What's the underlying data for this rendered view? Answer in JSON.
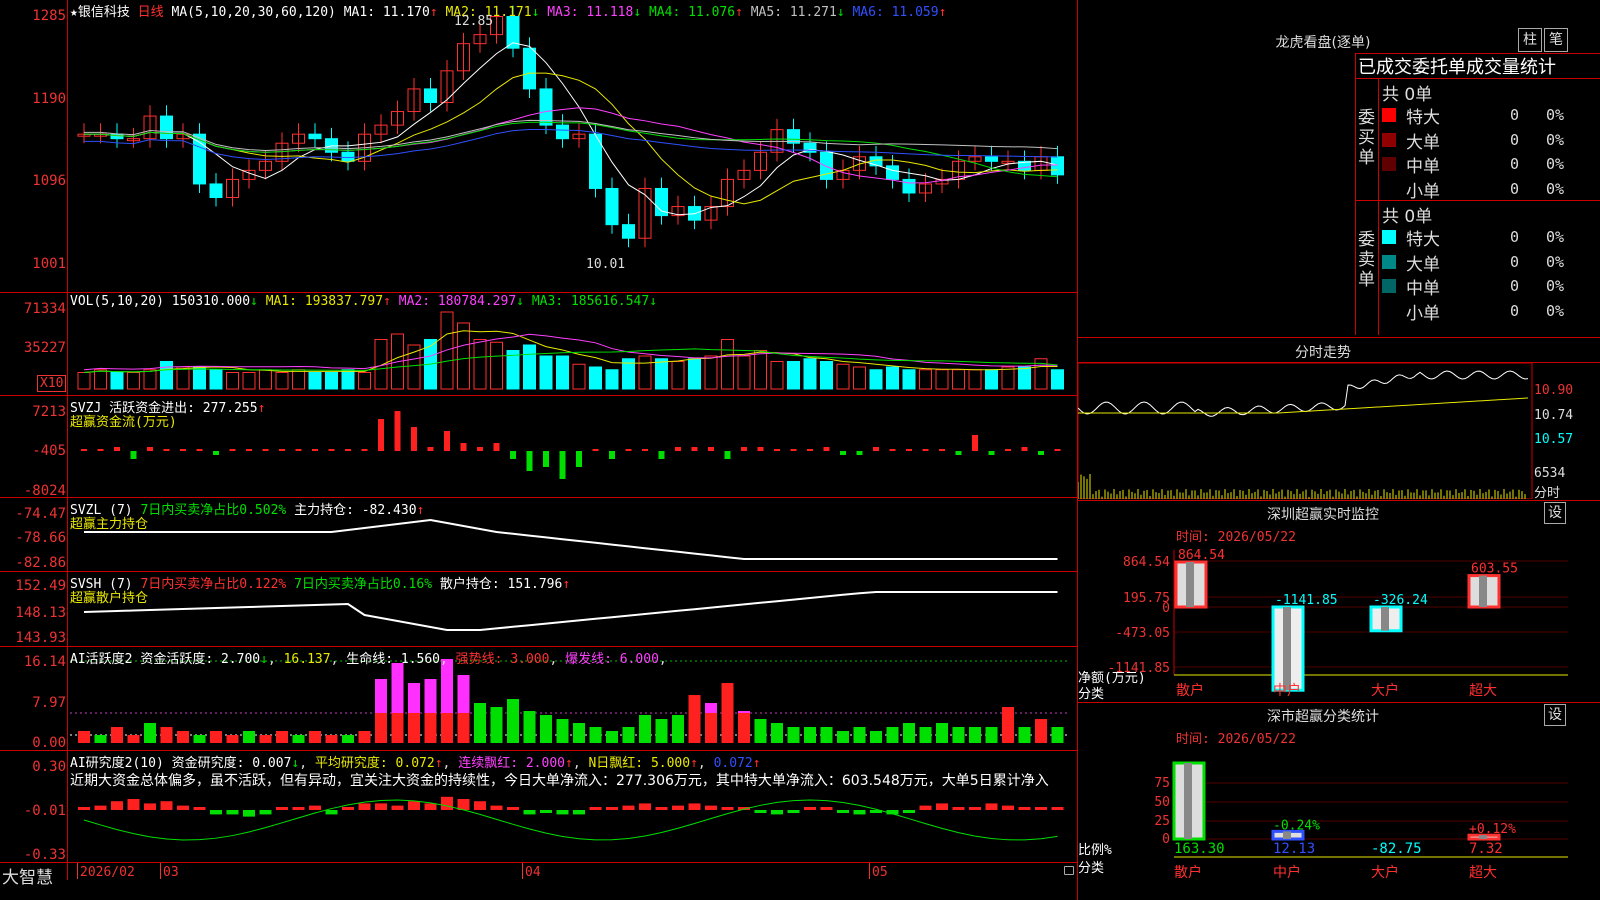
{
  "stock": {
    "name": "银信科技",
    "period": "日线",
    "star": "★"
  },
  "main_header": {
    "ma_param": "MA(5,10,20,30,60,120)",
    "items": [
      {
        "label": "MA1:",
        "value": "11.170",
        "arrow": "↑",
        "color": "#ffffff"
      },
      {
        "label": "MA2:",
        "value": "11.171",
        "arrow": "↓",
        "color": "#e8e800"
      },
      {
        "label": "MA3:",
        "value": "11.118",
        "arrow": "↓",
        "color": "#ff40ff"
      },
      {
        "label": "MA4:",
        "value": "11.076",
        "arrow": "↑",
        "color": "#00e000"
      },
      {
        "label": "MA5:",
        "value": "11.271",
        "arrow": "↓",
        "color": "#c0c0c0"
      },
      {
        "label": "MA6:",
        "value": "11.059",
        "arrow": "↑",
        "color": "#3050ff"
      }
    ]
  },
  "y_labels": {
    "price": [
      "1285",
      "1190",
      "1096",
      "1001"
    ],
    "vol": [
      "71334",
      "35227",
      "X10"
    ],
    "svzj": [
      "7213",
      "-405",
      "-8024"
    ],
    "svzl": [
      "-74.47",
      "-78.66",
      "-82.86"
    ],
    "svsh": [
      "152.49",
      "148.13",
      "143.93"
    ],
    "ai1": [
      "16.14",
      "7.97",
      "0.00"
    ],
    "ai2": [
      "0.30",
      "-0.01",
      "-0.33"
    ]
  },
  "price_annotations": {
    "high": "12.85",
    "low": "10.01"
  },
  "vol_header": {
    "param": "VOL(5,10,20)",
    "value": "150310.000",
    "arrow": "↓",
    "ma1": "MA1: 193837.797",
    "ma1_arrow": "↑",
    "ma2": "MA2: 180784.297",
    "ma2_arrow": "↓",
    "ma3": "MA3: 185616.547",
    "ma3_arrow": "↓"
  },
  "svzj_header": {
    "name": "SVZJ",
    "text": "活跃资金进出: 277.255",
    "arrow": "↑",
    "sub": "超赢资金流(万元)"
  },
  "svzl_header": {
    "name": "SVZL (7)",
    "text1": "7日内买卖净占比0.502%",
    "text2": "主力持仓: -82.430",
    "arrow": "↑",
    "sub": "超赢主力持仓"
  },
  "svsh_header": {
    "name": "SVSH (7)",
    "text1": "7日内买卖净占比0.122%",
    "text2": "7日内买卖净占比0.16%",
    "text3": "散户持仓: 151.796",
    "arrow": "↑",
    "sub": "超赢散户持仓"
  },
  "ai1_header": {
    "name": "AI活跃度2",
    "text": "资金活跃度: 2.700",
    "arrow": "↓",
    "v2": "16.137",
    "text2": "生命线: 1.560",
    "strong": "强势线: 3.000",
    "burst": "爆发线: 6.000"
  },
  "ai2_header": {
    "name": "AI研究度2(10)",
    "text": "资金研究度: 0.007",
    "arrow": "↓",
    "avg": "平均研究度: 0.072",
    "avg_arrow": "↑",
    "streak": "连续飘红: 2.000",
    "streak_arrow": "↑",
    "n": "N日飘红: 5.000",
    "n_arrow": "↑",
    "last": "0.072",
    "last_arrow": "↑"
  },
  "comment": "近期大资金总体偏多，虽不活跃，但有异动，宜关注大资金的持续性，今日大单净流入：277.306万元，其中特大单净流入：603.548万元，大单5日累计净入",
  "bottom_axis": {
    "brand": "大智慧",
    "labels": [
      "2026/02",
      "03",
      "04",
      "05"
    ]
  },
  "dragon": {
    "title": "龙虎看盘(逐单)",
    "btn1": "柱",
    "btn2": "笔",
    "subtitle": "已成交委托单成交量统计",
    "buy": {
      "side": "委买单",
      "total": "共 0单",
      "rows": [
        {
          "label": "特大",
          "count": "0",
          "pct": "0%",
          "color": "#ff0000"
        },
        {
          "label": "大单",
          "count": "0",
          "pct": "0%",
          "color": "#900000"
        },
        {
          "label": "中单",
          "count": "0",
          "pct": "0%",
          "color": "#600000"
        },
        {
          "label": "小单",
          "count": "0",
          "pct": "0%",
          "color": "#000000"
        }
      ]
    },
    "sell": {
      "side": "委卖单",
      "total": "共 0单",
      "rows": [
        {
          "label": "特大",
          "count": "0",
          "pct": "0%",
          "color": "#00ffff"
        },
        {
          "label": "大单",
          "count": "0",
          "pct": "0%",
          "color": "#008888"
        },
        {
          "label": "中单",
          "count": "0",
          "pct": "0%",
          "color": "#006666"
        },
        {
          "label": "小单",
          "count": "0",
          "pct": "0%",
          "color": "#000000"
        }
      ]
    }
  },
  "intraday": {
    "title": "分时走势",
    "labels": [
      "10.90",
      "10.74",
      "10.57",
      "6534",
      "分时"
    ]
  },
  "monitor": {
    "title": "深圳超赢实时监控",
    "btn": "设",
    "time": "时间: 2026/05/22",
    "y_labels": [
      "864.54",
      "195.75",
      "0",
      "-473.05",
      "-1141.85"
    ],
    "axis_label1": "净额(万元)",
    "axis_label2": "分类",
    "categories": [
      "散户",
      "中户",
      "大户",
      "超大"
    ],
    "values": [
      864.54,
      -1141.85,
      -326.24,
      603.55
    ],
    "value_labels": [
      "864.54",
      "-1141.85",
      "-326.24",
      "603.55"
    ]
  },
  "classify": {
    "title": "深市超赢分类统计",
    "btn": "设",
    "time": "时间: 2026/05/22",
    "y_labels": [
      "75",
      "50",
      "25",
      "0"
    ],
    "axis_label1": "比例%",
    "axis_label2": "分类",
    "categories": [
      "散户",
      "中户",
      "大户",
      "超大"
    ],
    "bars": [
      100,
      10,
      0,
      5
    ],
    "bar_labels": [
      "",
      "-0.24%",
      "",
      "+0.12%"
    ],
    "bottom_values": [
      "163.30",
      "12.13",
      "-82.75",
      "7.32"
    ]
  },
  "chart_data": [
    {
      "type": "candlestick",
      "title": "银信科技 日线",
      "x": [
        "2026/02",
        "03",
        "04",
        "05"
      ],
      "ylim": [
        10.01,
        12.85
      ],
      "series": [
        {
          "name": "MA1",
          "last": 11.17
        },
        {
          "name": "MA2",
          "last": 11.171
        },
        {
          "name": "MA3",
          "last": 11.118
        },
        {
          "name": "MA4",
          "last": 11.076
        },
        {
          "name": "MA5",
          "last": 11.271
        },
        {
          "name": "MA6",
          "last": 11.059
        }
      ],
      "annotations": [
        {
          "label": "12.85"
        },
        {
          "label": "10.01"
        }
      ]
    },
    {
      "type": "bar",
      "title": "VOL(5,10,20)",
      "values_last": 150310.0,
      "series": [
        {
          "name": "MA1",
          "last": 193837.797
        },
        {
          "name": "MA2",
          "last": 180784.297
        },
        {
          "name": "MA3",
          "last": 185616.547
        }
      ]
    },
    {
      "type": "bar",
      "title": "SVZJ",
      "series": [
        {
          "name": "活跃资金进出",
          "last": 277.255
        }
      ]
    },
    {
      "type": "line",
      "title": "SVZL (7)",
      "series": [
        {
          "name": "主力持仓",
          "last": -82.43
        }
      ]
    },
    {
      "type": "line",
      "title": "SVSH (7)",
      "series": [
        {
          "name": "散户持仓",
          "last": 151.796
        }
      ]
    },
    {
      "type": "bar",
      "title": "AI活跃度2",
      "series": [
        {
          "name": "资金活跃度",
          "last": 2.7
        },
        {
          "name": "生命线",
          "last": 1.56
        }
      ],
      "lines": {
        "强势线": 3.0,
        "爆发线": 6.0
      }
    },
    {
      "type": "bar",
      "title": "AI研究度2(10)",
      "series": [
        {
          "name": "资金研究度",
          "last": 0.007
        },
        {
          "name": "平均研究度",
          "last": 0.072
        }
      ]
    },
    {
      "type": "bar",
      "title": "深圳超赢实时监控",
      "categories": [
        "散户",
        "中户",
        "大户",
        "超大"
      ],
      "values": [
        864.54,
        -1141.85,
        -326.24,
        603.55
      ],
      "ylabel": "净额(万元)",
      "xlabel": "分类"
    },
    {
      "type": "bar",
      "title": "深市超赢分类统计",
      "categories": [
        "散户",
        "中户",
        "大户",
        "超大"
      ],
      "values": [
        163.3,
        12.13,
        -82.75,
        7.32
      ],
      "ylabel": "比例%",
      "xlabel": "分类"
    }
  ]
}
